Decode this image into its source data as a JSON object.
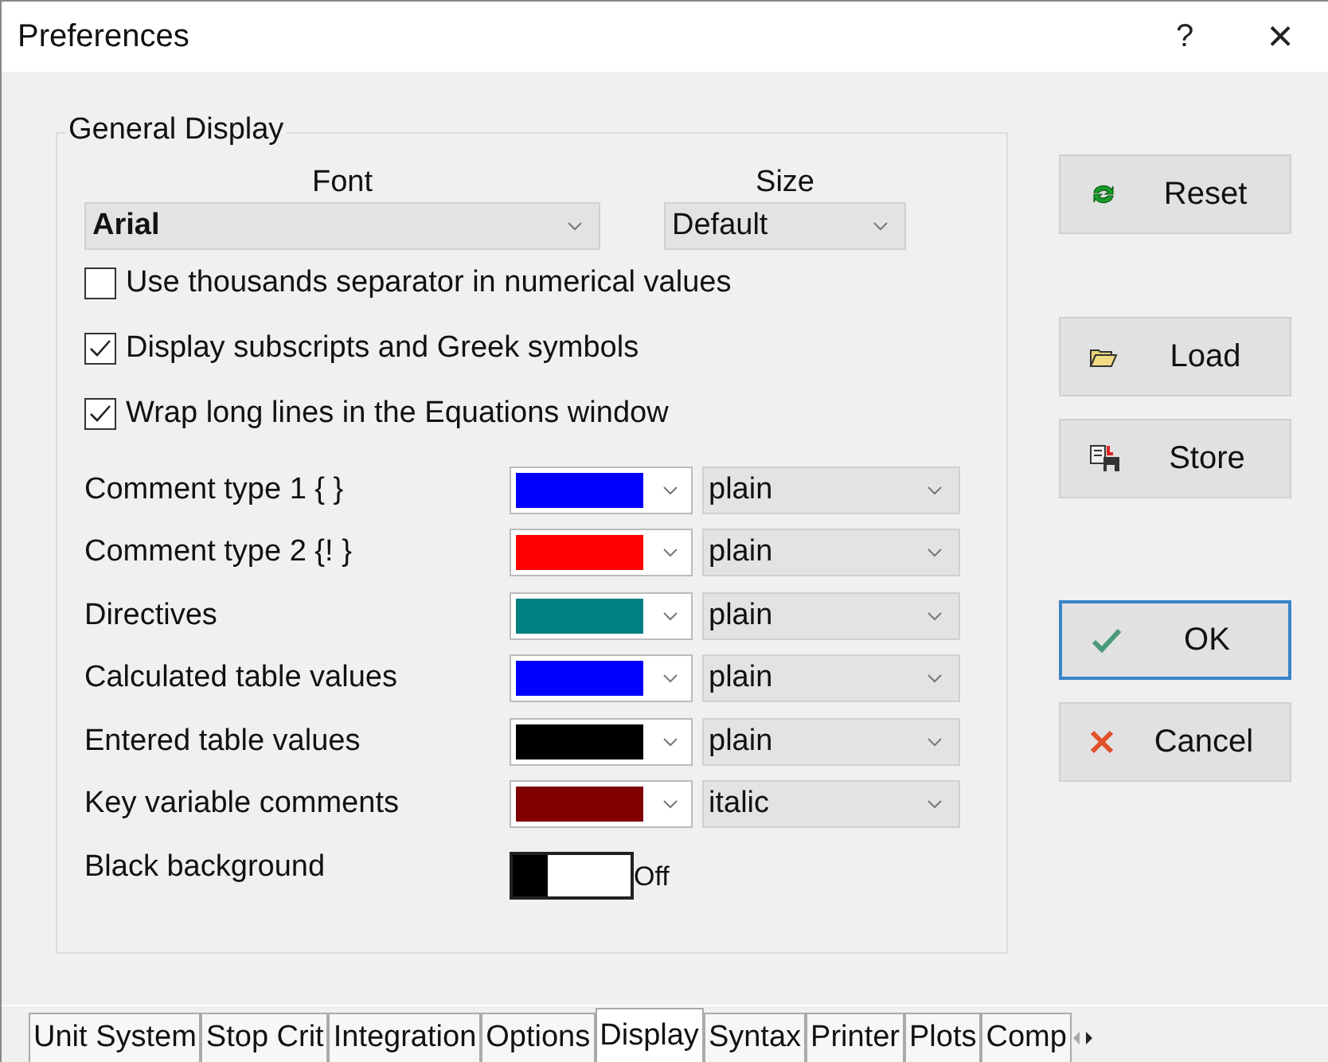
{
  "window": {
    "title": "Preferences",
    "help": "?",
    "close": "×"
  },
  "general_display": {
    "title": "General Display",
    "font": {
      "label": "Font",
      "value": "Arial"
    },
    "size": {
      "label": "Size",
      "value": "Default"
    },
    "options": [
      {
        "label": "Use thousands separator in numerical values",
        "checked": false
      },
      {
        "label": "Display subscripts and Greek symbols",
        "checked": true
      },
      {
        "label": "Wrap long lines in the Equations window",
        "checked": true
      }
    ],
    "styles": [
      {
        "label": "Comment type 1 {  }",
        "color": "#0000ff",
        "style": "plain"
      },
      {
        "label": "Comment type 2 {!  }",
        "color": "#ff0000",
        "style": "plain"
      },
      {
        "label": "Directives",
        "color": "#008080",
        "style": "plain"
      },
      {
        "label": "Calculated table values",
        "color": "#0000ff",
        "style": "plain"
      },
      {
        "label": "Entered table values",
        "color": "#000000",
        "style": "plain"
      },
      {
        "label": "Key variable comments",
        "color": "#800000",
        "style": "italic"
      }
    ],
    "black_background": {
      "label": "Black background",
      "on": false,
      "state": "Off"
    }
  },
  "buttons": [
    {
      "kind": "reset",
      "label": "Reset",
      "default": false
    },
    {
      "kind": "load",
      "label": "Load",
      "default": false
    },
    {
      "kind": "store",
      "label": "Store",
      "default": false
    },
    {
      "kind": "ok",
      "label": "OK",
      "default": true
    },
    {
      "kind": "cancel",
      "label": "Cancel",
      "default": false
    }
  ],
  "tabs": [
    {
      "label": "Unit System",
      "selected": false
    },
    {
      "label": "Stop Crit",
      "selected": false
    },
    {
      "label": "Integration",
      "selected": false
    },
    {
      "label": "Options",
      "selected": false
    },
    {
      "label": "Display",
      "selected": true
    },
    {
      "label": "Syntax",
      "selected": false
    },
    {
      "label": "Printer",
      "selected": false
    },
    {
      "label": "Plots",
      "selected": false
    },
    {
      "label": "Comp",
      "selected": false
    }
  ]
}
